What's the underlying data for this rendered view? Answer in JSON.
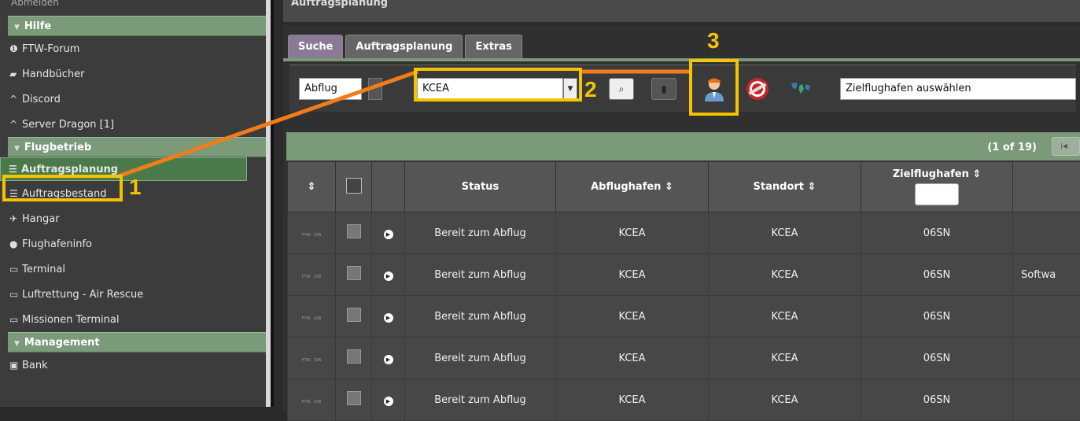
{
  "sidebar": {
    "top_partial": "Abmelden",
    "sections": [
      {
        "title": "Hilfe",
        "items": [
          {
            "label": "FTW-Forum",
            "icon": "info-icon"
          },
          {
            "label": "Handbücher",
            "icon": "book-icon"
          },
          {
            "label": "Discord",
            "icon": "caret-up-icon"
          },
          {
            "label": "Server Dragon [1]",
            "icon": "caret-up-icon"
          }
        ]
      },
      {
        "title": "Flugbetrieb",
        "items": [
          {
            "label": "Auftragsplanung",
            "icon": "list-icon"
          },
          {
            "label": "Auftragsbestand",
            "icon": "list-icon"
          },
          {
            "label": "Hangar",
            "icon": "plane-icon"
          },
          {
            "label": "Flughafeninfo",
            "icon": "globe-icon"
          },
          {
            "label": "Terminal",
            "icon": "laptop-icon"
          },
          {
            "label": "Luftrettung - Air Rescue",
            "icon": "laptop-icon"
          },
          {
            "label": "Missionen Terminal",
            "icon": "laptop-icon"
          }
        ]
      },
      {
        "title": "Management",
        "items": [
          {
            "label": "Bank",
            "icon": "money-icon"
          }
        ]
      }
    ]
  },
  "panel": {
    "title": "Auftragsplanung"
  },
  "tabs": [
    "Suche",
    "Auftragsplanung",
    "Extras"
  ],
  "toolbar": {
    "mode_value": "Abflug",
    "airport_value": "KCEA",
    "destination_placeholder": "Zielflughafen auswählen"
  },
  "annotations": [
    "1",
    "2",
    "3"
  ],
  "grid": {
    "pager": "(1 of 19)",
    "columns": [
      "",
      "",
      "",
      "Status",
      "Abflughafen",
      "Standort",
      "Zielflughafen",
      ""
    ],
    "sort_mark": "⇕",
    "rows": [
      {
        "logo": "FTW · JOB",
        "status": "Bereit zum Abflug",
        "from": "KCEA",
        "loc": "KCEA",
        "to": "06SN",
        "extra": ""
      },
      {
        "logo": "FTW · JOB",
        "status": "Bereit zum Abflug",
        "from": "KCEA",
        "loc": "KCEA",
        "to": "06SN",
        "extra": "Softwa"
      },
      {
        "logo": "FTW · JOB",
        "status": "Bereit zum Abflug",
        "from": "KCEA",
        "loc": "KCEA",
        "to": "06SN",
        "extra": ""
      },
      {
        "logo": "FTW · JOB",
        "status": "Bereit zum Abflug",
        "from": "KCEA",
        "loc": "KCEA",
        "to": "06SN",
        "extra": ""
      },
      {
        "logo": "FTW · JOB",
        "status": "Bereit zum Abflug",
        "from": "KCEA",
        "loc": "KCEA",
        "to": "06SN",
        "extra": ""
      }
    ]
  },
  "colors": {
    "highlight": "#f5c400",
    "connector": "#f07c1a",
    "header_green": "#7a9a7a"
  }
}
